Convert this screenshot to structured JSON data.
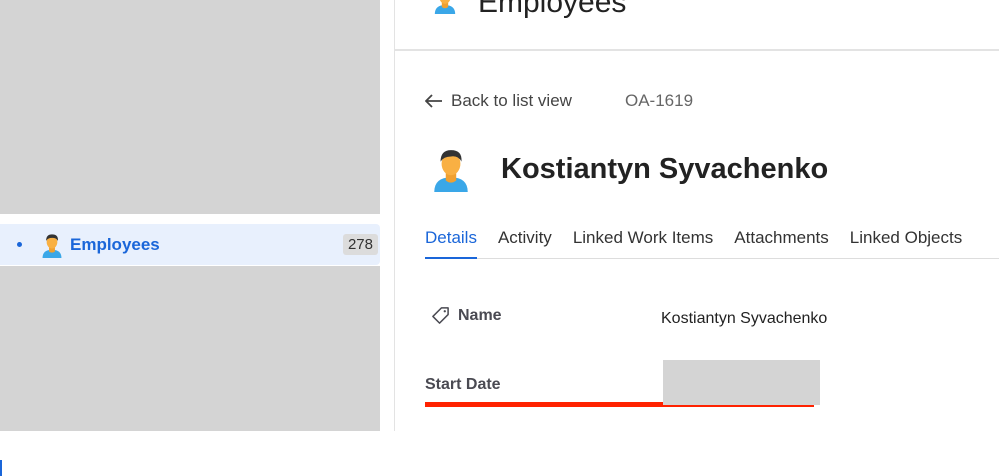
{
  "sidebar": {
    "active_item": {
      "label": "Employees",
      "count": "278",
      "icon": "employee-emoji-icon"
    }
  },
  "header": {
    "title": "Employees"
  },
  "record": {
    "back_label": "Back to list view",
    "id": "OA-1619",
    "name": "Kostiantyn Syvachenko"
  },
  "tabs": [
    {
      "label": "Details",
      "active": true
    },
    {
      "label": "Activity"
    },
    {
      "label": "Linked Work Items"
    },
    {
      "label": "Attachments"
    },
    {
      "label": "Linked Objects"
    }
  ],
  "fields": {
    "name_label": "Name",
    "name_value": "Kostiantyn Syvachenko",
    "start_date_label": "Start Date"
  },
  "colors": {
    "accent": "#1a66d9",
    "highlight": "#ff2200"
  }
}
